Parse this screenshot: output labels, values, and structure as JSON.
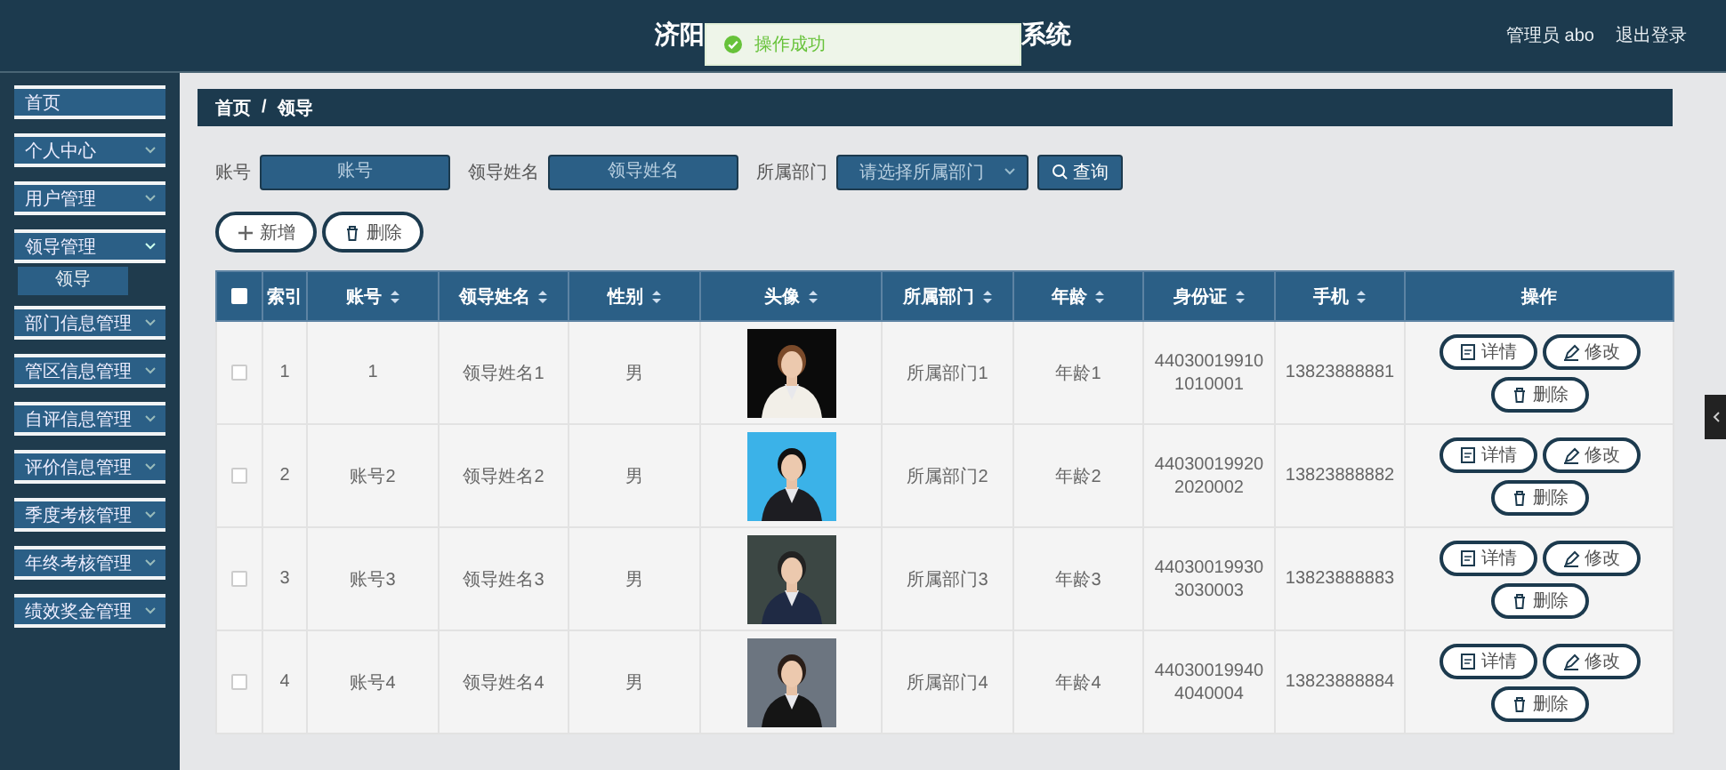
{
  "header": {
    "title_start": "济阳",
    "title_end": "系统",
    "user": "管理员 abo",
    "logout": "退出登录"
  },
  "toast": {
    "message": "操作成功"
  },
  "sidebar": {
    "items": [
      {
        "label": "首页",
        "kind": "link"
      },
      {
        "label": "个人中心",
        "kind": "menu",
        "expanded": false
      },
      {
        "label": "用户管理",
        "kind": "menu",
        "expanded": false
      },
      {
        "label": "领导管理",
        "kind": "menu",
        "expanded": true,
        "children": [
          {
            "label": "领导",
            "selected": true
          }
        ]
      },
      {
        "label": "部门信息管理",
        "kind": "menu",
        "expanded": false
      },
      {
        "label": "管区信息管理",
        "kind": "menu",
        "expanded": false
      },
      {
        "label": "自评信息管理",
        "kind": "menu",
        "expanded": false
      },
      {
        "label": "评价信息管理",
        "kind": "menu",
        "expanded": false
      },
      {
        "label": "季度考核管理",
        "kind": "menu",
        "expanded": false
      },
      {
        "label": "年终考核管理",
        "kind": "menu",
        "expanded": false
      },
      {
        "label": "绩效奖金管理",
        "kind": "menu",
        "expanded": false
      }
    ]
  },
  "breadcrumb": {
    "items": [
      "首页",
      "领导"
    ],
    "separator": "/"
  },
  "search": {
    "fields": [
      {
        "label": "账号",
        "placeholder": "账号",
        "kind": "input"
      },
      {
        "label": "领导姓名",
        "placeholder": "领导姓名",
        "kind": "input"
      },
      {
        "label": "所属部门",
        "placeholder": "请选择所属部门",
        "kind": "select"
      }
    ],
    "button": "查询"
  },
  "actions": [
    {
      "label": "新增",
      "kind": "add"
    },
    {
      "label": "删除",
      "kind": "delete"
    }
  ],
  "table": {
    "select_all": {
      "checked": false
    },
    "columns": [
      {
        "label": "索引",
        "sortable": false
      },
      {
        "label": "账号",
        "sortable": true
      },
      {
        "label": "领导姓名",
        "sortable": true
      },
      {
        "label": "性别",
        "sortable": true
      },
      {
        "label": "头像",
        "sortable": true
      },
      {
        "label": "所属部门",
        "sortable": true
      },
      {
        "label": "年龄",
        "sortable": true
      },
      {
        "label": "身份证",
        "sortable": true
      },
      {
        "label": "手机",
        "sortable": true
      },
      {
        "label": "操作",
        "sortable": false
      }
    ],
    "rows": [
      {
        "checked": false,
        "cells": [
          "1",
          "1",
          "领导姓名1",
          "男"
        ],
        "avatar": {
          "kind": "picture"
        },
        "cells_after": [
          "所属部门1",
          "年龄1",
          "440300199101010001",
          "13823888881"
        ],
        "actions": [
          {
            "label": "详情",
            "kind": "detail"
          },
          {
            "label": "修改",
            "kind": "edit"
          },
          {
            "label": "删除",
            "kind": "delete"
          }
        ]
      },
      {
        "checked": false,
        "cells": [
          "2",
          "账号2",
          "领导姓名2",
          "男"
        ],
        "avatar": {
          "kind": "picture"
        },
        "cells_after": [
          "所属部门2",
          "年龄2",
          "440300199202020002",
          "13823888882"
        ],
        "actions": [
          {
            "label": "详情",
            "kind": "detail"
          },
          {
            "label": "修改",
            "kind": "edit"
          },
          {
            "label": "删除",
            "kind": "delete"
          }
        ]
      },
      {
        "checked": false,
        "cells": [
          "3",
          "账号3",
          "领导姓名3",
          "男"
        ],
        "avatar": {
          "kind": "picture"
        },
        "cells_after": [
          "所属部门3",
          "年龄3",
          "440300199303030003",
          "13823888883"
        ],
        "actions": [
          {
            "label": "详情",
            "kind": "detail"
          },
          {
            "label": "修改",
            "kind": "edit"
          },
          {
            "label": "删除",
            "kind": "delete"
          }
        ]
      },
      {
        "checked": false,
        "cells": [
          "4",
          "账号4",
          "领导姓名4",
          "男"
        ],
        "avatar": {
          "kind": "picture"
        },
        "cells_after": [
          "所属部门4",
          "年龄4",
          "440300199404040004",
          "13823888884"
        ],
        "actions": [
          {
            "label": "详情",
            "kind": "detail"
          },
          {
            "label": "修改",
            "kind": "edit"
          },
          {
            "label": "删除",
            "kind": "delete"
          }
        ]
      }
    ]
  }
}
